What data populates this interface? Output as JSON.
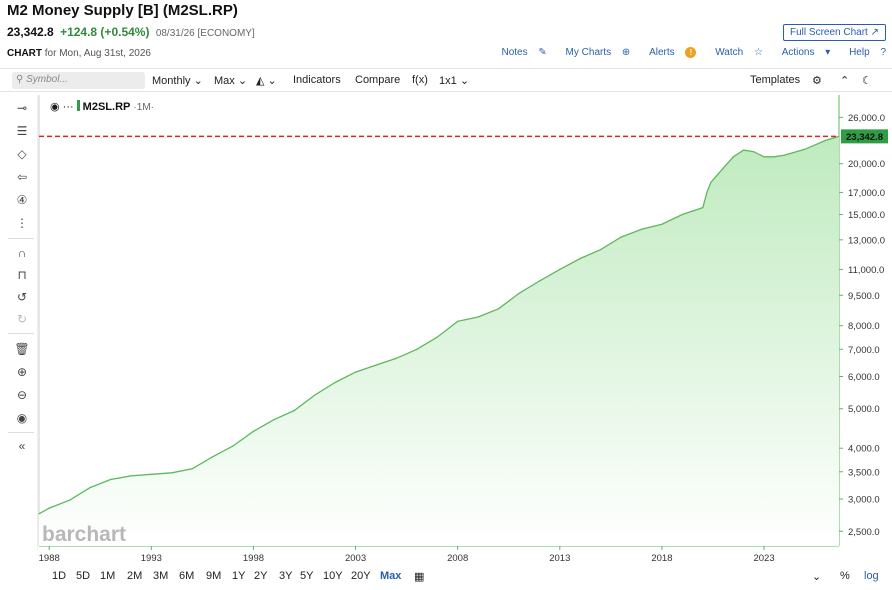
{
  "header": {
    "title": "M2 Money Supply [B] (M2SL.RP)",
    "last": "23,342.8",
    "change": "+124.8 (+0.54%)",
    "date_meta": "08/31/26 [ECONOMY]",
    "full_screen_label": "Full Screen Chart",
    "chart_label": "CHART",
    "chart_for": "for Mon, Aug 31st, 2026",
    "links": {
      "notes": "Notes",
      "my_charts": "My Charts",
      "alerts": "Alerts",
      "watch": "Watch",
      "actions": "Actions",
      "help": "Help",
      "alert_badge": "!"
    }
  },
  "toolbar": {
    "symbol_placeholder": "Symbol...",
    "interval": "Monthly",
    "range": "Max",
    "indicators": "Indicators",
    "compare": "Compare",
    "fx": "f(x)",
    "layout": "1x1",
    "templates": "Templates"
  },
  "series": {
    "symbol": "M2SL.RP",
    "period": "·1M·"
  },
  "watermark": "barchart",
  "bottom_ranges": [
    "1D",
    "5D",
    "1M",
    "2M",
    "3M",
    "6M",
    "9M",
    "1Y",
    "2Y",
    "3Y",
    "5Y",
    "10Y",
    "20Y",
    "Max"
  ],
  "active_range": "Max",
  "bottom_right": {
    "pct": "%",
    "log": "log"
  },
  "colors": {
    "line": "#5cb85c",
    "fill_top": "#bfeabf",
    "fill_bottom": "#ffffff",
    "last_line": "#e02424",
    "last_bg": "#2e9d45",
    "accent": "#2a5db0"
  },
  "chart_data": {
    "type": "area",
    "y_scale": "log",
    "ylim": [
      2300,
      29500
    ],
    "xlim": [
      1987.5,
      2026.67
    ],
    "x_ticks": [
      1988,
      1993,
      1998,
      2003,
      2008,
      2013,
      2018,
      2023
    ],
    "y_ticks": [
      {
        "v": 2500,
        "label": "2,500.0"
      },
      {
        "v": 3000,
        "label": "3,000.0"
      },
      {
        "v": 3500,
        "label": "3,500.0"
      },
      {
        "v": 4000,
        "label": "4,000.0"
      },
      {
        "v": 5000,
        "label": "5,000.0"
      },
      {
        "v": 6000,
        "label": "6,000.0"
      },
      {
        "v": 7000,
        "label": "7,000.0"
      },
      {
        "v": 8000,
        "label": "8,000.0"
      },
      {
        "v": 9500,
        "label": "9,500.0"
      },
      {
        "v": 11000,
        "label": "11,000.0"
      },
      {
        "v": 13000,
        "label": "13,000.0"
      },
      {
        "v": 15000,
        "label": "15,000.0"
      },
      {
        "v": 17000,
        "label": "17,000.0"
      },
      {
        "v": 20000,
        "label": "20,000.0"
      },
      {
        "v": 26000,
        "label": "26,000.0"
      }
    ],
    "last_value": 23342.8,
    "last_label": "23,342.8",
    "x": [
      1987.5,
      1988,
      1989,
      1990,
      1991,
      1992,
      1993,
      1994,
      1995,
      1996,
      1997,
      1998,
      1999,
      2000,
      2001,
      2002,
      2003,
      2004,
      2005,
      2006,
      2007,
      2008,
      2009,
      2010,
      2011,
      2012,
      2013,
      2014,
      2015,
      2016,
      2017,
      2018,
      2019,
      2020,
      2020.2,
      2020.4,
      2021,
      2021.5,
      2022,
      2022.5,
      2023,
      2023.5,
      2024,
      2025,
      2026,
      2026.67
    ],
    "values": [
      2760,
      2850,
      2980,
      3200,
      3350,
      3420,
      3450,
      3480,
      3560,
      3810,
      4050,
      4400,
      4700,
      4950,
      5400,
      5800,
      6150,
      6400,
      6650,
      7000,
      7500,
      8200,
      8400,
      8800,
      9600,
      10300,
      11000,
      11700,
      12300,
      13200,
      13800,
      14200,
      15000,
      15600,
      17000,
      18000,
      19500,
      20800,
      21600,
      21400,
      20800,
      20800,
      21000,
      21700,
      22800,
      23342.8
    ]
  }
}
